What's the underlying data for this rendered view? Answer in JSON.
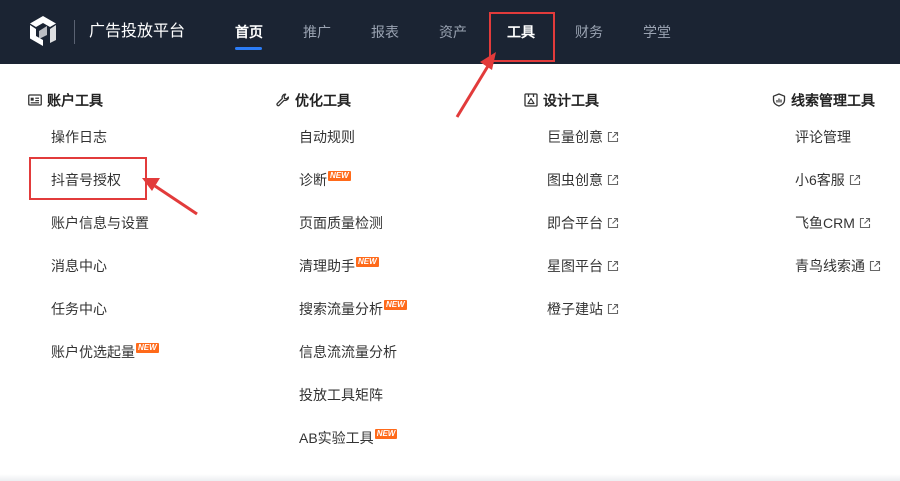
{
  "header": {
    "brand": "广告投放平台",
    "nav": [
      "首页",
      "推广",
      "报表",
      "资产",
      "工具",
      "财务",
      "学堂"
    ],
    "active_index": 0,
    "highlighted_index": 4,
    "colors": {
      "bg": "#1b2433",
      "active_underline": "#2b7cf6",
      "annotation": "#e23b3b"
    }
  },
  "columns": [
    {
      "title": "账户工具",
      "icon": "id-card-icon",
      "items": [
        {
          "label": "操作日志"
        },
        {
          "label": "抖音号授权",
          "highlighted": true
        },
        {
          "label": "账户信息与设置"
        },
        {
          "label": "消息中心"
        },
        {
          "label": "任务中心"
        },
        {
          "label": "账户优选起量",
          "badge": "NEW"
        }
      ]
    },
    {
      "title": "优化工具",
      "icon": "wrench-icon",
      "items": [
        {
          "label": "自动规则"
        },
        {
          "label": "诊断",
          "badge": "NEW"
        },
        {
          "label": "页面质量检测"
        },
        {
          "label": "清理助手",
          "badge": "NEW"
        },
        {
          "label": "搜索流量分析",
          "badge": "NEW"
        },
        {
          "label": "信息流流量分析"
        },
        {
          "label": "投放工具矩阵"
        },
        {
          "label": "AB实验工具",
          "badge": "NEW"
        }
      ]
    },
    {
      "title": "设计工具",
      "icon": "design-icon",
      "items": [
        {
          "label": "巨量创意",
          "external": true
        },
        {
          "label": "图虫创意",
          "external": true
        },
        {
          "label": "即合平台",
          "external": true
        },
        {
          "label": "星图平台",
          "external": true
        },
        {
          "label": "橙子建站",
          "external": true
        }
      ]
    },
    {
      "title": "线索管理工具",
      "icon": "shield-icon",
      "items": [
        {
          "label": "评论管理"
        },
        {
          "label": "小6客服",
          "external": true
        },
        {
          "label": "飞鱼CRM",
          "external": true
        },
        {
          "label": "青鸟线索通",
          "external": true
        }
      ]
    }
  ]
}
